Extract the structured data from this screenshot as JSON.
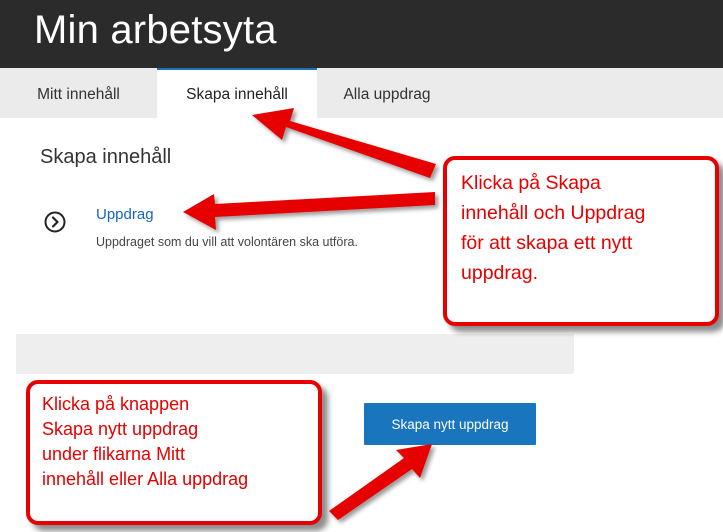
{
  "header": {
    "title": "Min arbetsyta"
  },
  "tabs": [
    {
      "label": "Mitt innehåll"
    },
    {
      "label": "Skapa innehåll"
    },
    {
      "label": "Alla uppdrag"
    }
  ],
  "content": {
    "section_title": "Skapa innehåll",
    "item": {
      "icon": "chevron-circle-right-icon",
      "link": "Uppdrag",
      "description": "Uppdraget som du vill att volontären ska utföra."
    },
    "create_button": "Skapa nytt uppdrag"
  },
  "annotations": {
    "top_callout": [
      "Klicka på Skapa",
      "innehåll och Uppdrag",
      "för att skapa ett nytt",
      "uppdrag."
    ],
    "bottom_callout": [
      "Klicka på knappen",
      "Skapa nytt uppdrag",
      "under flikarna Mitt",
      "innehåll eller Alla uppdrag"
    ],
    "color": "#e60000"
  },
  "colors": {
    "header_bg": "#2b2b2b",
    "accent": "#1976be",
    "link": "#1565c0"
  }
}
